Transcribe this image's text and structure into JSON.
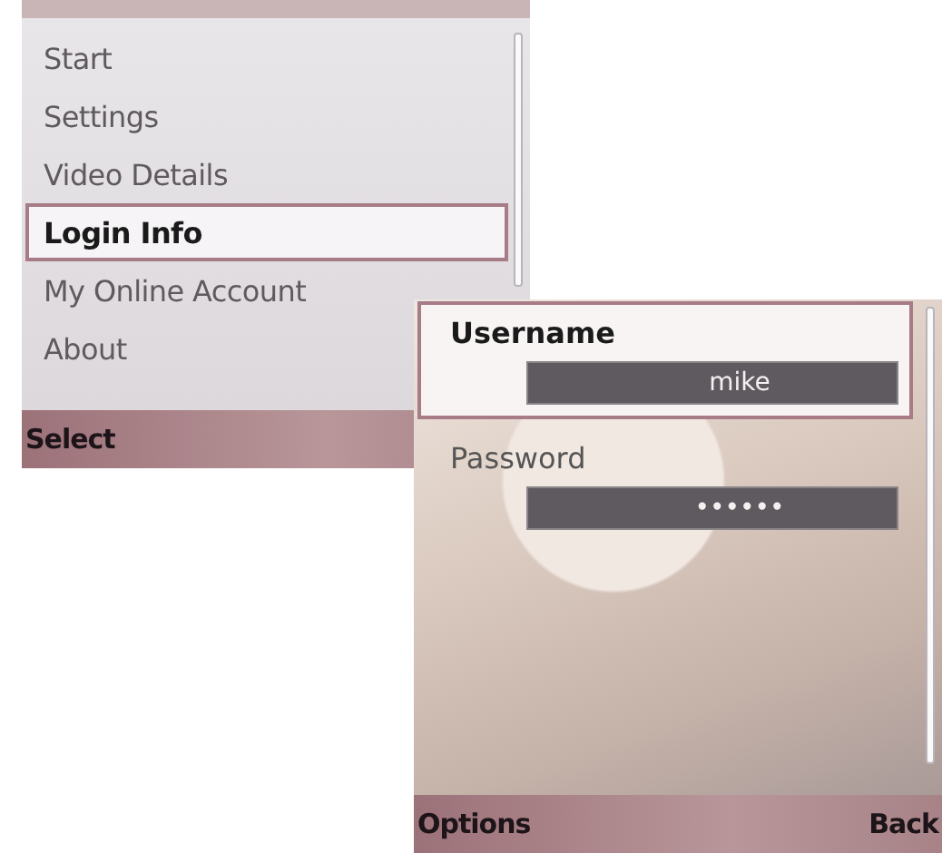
{
  "menu": {
    "items": [
      {
        "label": "Start",
        "selected": false
      },
      {
        "label": "Settings",
        "selected": false
      },
      {
        "label": "Video Details",
        "selected": false
      },
      {
        "label": "Login Info",
        "selected": true
      },
      {
        "label": "My Online Account",
        "selected": false
      },
      {
        "label": "About",
        "selected": false
      }
    ],
    "softkeys": [
      "Select"
    ]
  },
  "login": {
    "fields": [
      {
        "label": "Username",
        "value": "mike",
        "selected": true
      },
      {
        "label": "Password",
        "value": "••••••",
        "selected": false
      }
    ],
    "softkeys": [
      "Options",
      "Back"
    ]
  }
}
